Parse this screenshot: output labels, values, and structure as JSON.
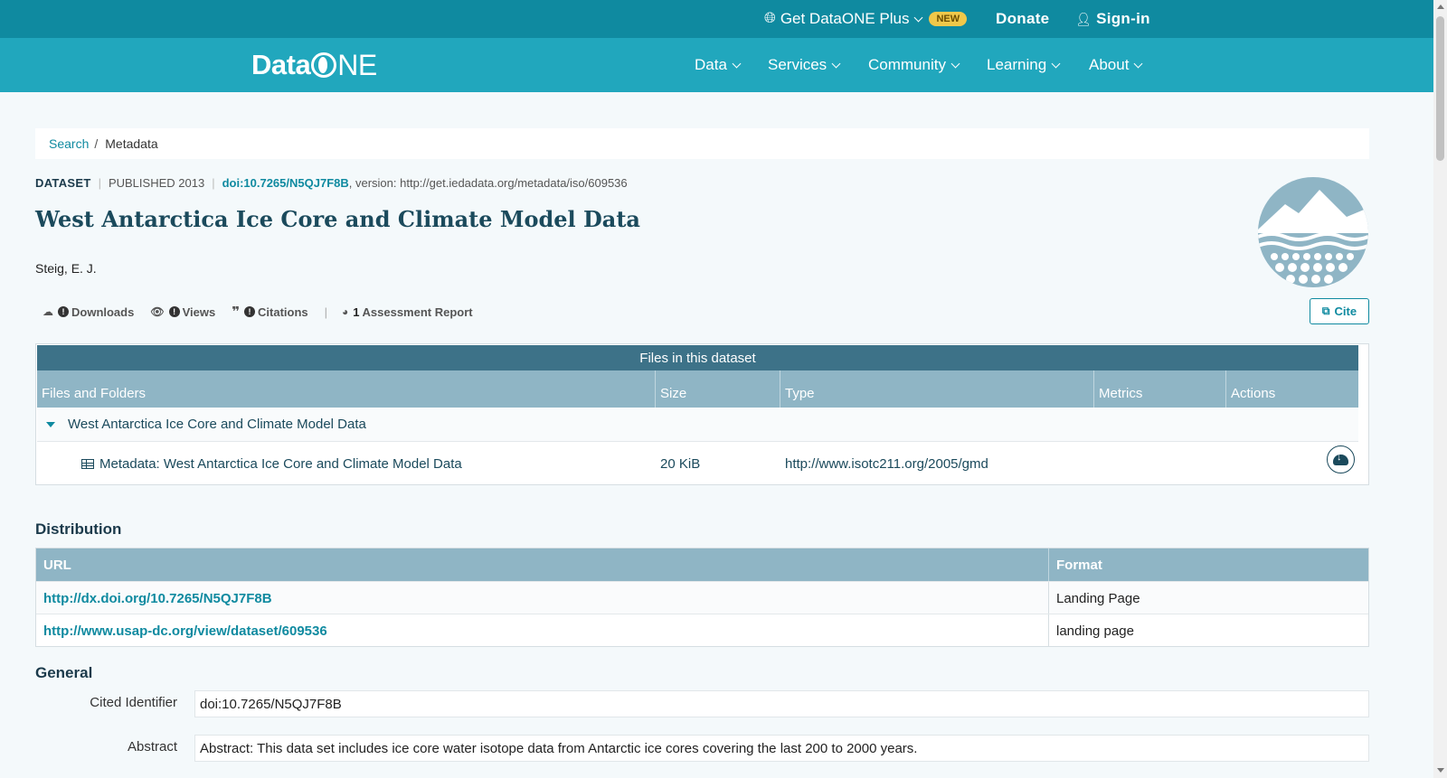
{
  "topbar": {
    "plus_label": "Get DataONE Plus",
    "new_badge": "NEW",
    "donate": "Donate",
    "signin": "Sign-in"
  },
  "nav": {
    "logo_prefix": "Data",
    "logo_suffix": "NE",
    "items": [
      "Data",
      "Services",
      "Community",
      "Learning",
      "About"
    ]
  },
  "breadcrumb": {
    "search": "Search",
    "separator": "/",
    "current": "Metadata"
  },
  "dataset": {
    "kind": "DATASET",
    "published": "PUBLISHED 2013",
    "doi": "doi:10.7265/N5QJ7F8B",
    "version": ", version: http://get.iedadata.org/metadata/iso/609536",
    "title": "West Antarctica Ice Core and Climate Model Data",
    "author": "Steig, E. J."
  },
  "metrics": {
    "downloads": "Downloads",
    "views": "Views",
    "citations": "Citations",
    "assessment_count": "1",
    "assessment": "Assessment Report",
    "cite": "Cite"
  },
  "files": {
    "title": "Files in this dataset",
    "headers": [
      "Files and Folders",
      "Size",
      "Type",
      "Metrics",
      "Actions"
    ],
    "folder": "West Antarctica Ice Core and Climate Model Data",
    "rows": [
      {
        "name": "Metadata: West Antarctica Ice Core and Climate Model Data",
        "size": "20 KiB",
        "type": "http://www.isotc211.org/2005/gmd"
      }
    ]
  },
  "distribution": {
    "heading": "Distribution",
    "headers": [
      "URL",
      "Format"
    ],
    "rows": [
      {
        "url": "http://dx.doi.org/10.7265/N5QJ7F8B",
        "format": "Landing Page"
      },
      {
        "url": "http://www.usap-dc.org/view/dataset/609536",
        "format": "landing page"
      }
    ]
  },
  "general": {
    "heading": "General",
    "cited_identifier_label": "Cited Identifier",
    "cited_identifier": "doi:10.7265/N5QJ7F8B",
    "abstract_label": "Abstract",
    "abstract": "Abstract: This data set includes ice core water isotope data from Antarctic ice cores covering the last 200 to 2000 years."
  },
  "colors": {
    "topbar": "#0f8aa0",
    "navbar": "#21a7bd",
    "table_title": "#3d7288",
    "table_header": "#8fb5c5",
    "link": "#0f8aa0"
  }
}
